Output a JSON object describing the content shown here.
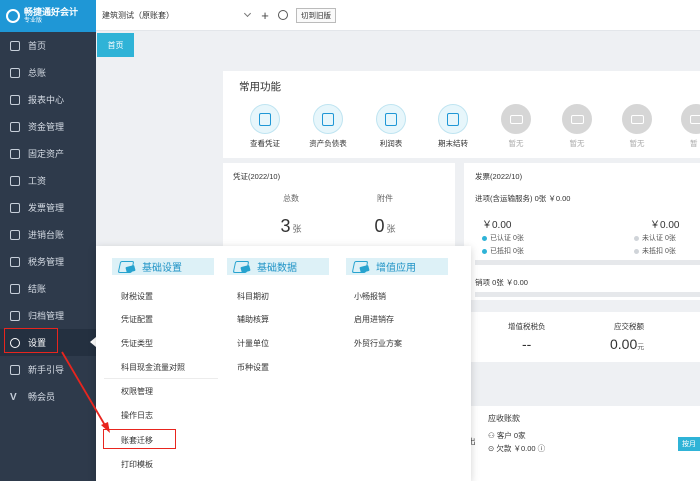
{
  "logo": {
    "title": "畅捷通好会计",
    "edition": "专业版"
  },
  "sidebar": {
    "items": [
      {
        "label": "首页",
        "icon": "home-icon"
      },
      {
        "label": "总账",
        "icon": "ledger-icon"
      },
      {
        "label": "报表中心",
        "icon": "chart-icon"
      },
      {
        "label": "资金管理",
        "icon": "wallet-icon"
      },
      {
        "label": "固定资产",
        "icon": "asset-icon"
      },
      {
        "label": "工资",
        "icon": "salary-icon"
      },
      {
        "label": "发票管理",
        "icon": "invoice-icon"
      },
      {
        "label": "进销台账",
        "icon": "inventory-icon"
      },
      {
        "label": "税务管理",
        "icon": "tax-icon"
      },
      {
        "label": "结账",
        "icon": "close-books-icon"
      },
      {
        "label": "归档管理",
        "icon": "archive-icon"
      },
      {
        "label": "设置",
        "icon": "gear-icon"
      },
      {
        "label": "新手引导",
        "icon": "guide-icon"
      },
      {
        "label": "畅会员",
        "icon": "vip-icon"
      }
    ]
  },
  "topbar": {
    "account_name": "建筑测试（原账套）",
    "switch_label": "切到旧版"
  },
  "tabs": {
    "home": "首页"
  },
  "quick": {
    "title": "常用功能",
    "items": [
      {
        "label": "查看凭证",
        "disabled": false
      },
      {
        "label": "资产负债表",
        "disabled": false
      },
      {
        "label": "利润表",
        "disabled": false
      },
      {
        "label": "期末结转",
        "disabled": false
      },
      {
        "label": "暂无",
        "disabled": true
      },
      {
        "label": "暂无",
        "disabled": true
      },
      {
        "label": "暂无",
        "disabled": true
      },
      {
        "label": "暂",
        "disabled": true
      }
    ]
  },
  "voucher": {
    "title": "凭证(2022/10)",
    "total_label": "总数",
    "total_value": "3",
    "total_unit": "张",
    "attach_label": "附件",
    "attach_value": "0",
    "attach_unit": "张"
  },
  "invoice": {
    "title": "发票(2022/10)",
    "input_line": "进项(含运输服务)  0张  ￥0.00",
    "left_amount": "￥0.00",
    "right_amount": "￥0.00",
    "certified": "已认证  0张",
    "uncertified": "未认证  0张",
    "deducted": "已抵扣  0张",
    "undeducted": "未抵扣  0张",
    "output_line": "销项   0张   ￥0.00"
  },
  "tax": {
    "vat_label": "增值税税负",
    "vat_value": "--",
    "due_label": "应交税额",
    "due_value": "0.00",
    "due_unit": "元"
  },
  "receivable": {
    "title": "应收账款",
    "customers": "客户  0家",
    "owed": "欠款  ￥0.00",
    "month_btn": "按月",
    "edge_text": "出"
  },
  "menu": {
    "basic_settings": {
      "title": "基础设置",
      "items": [
        "财税设置",
        "凭证配置",
        "凭证类型",
        "科目现金流量对照",
        "权限管理",
        "操作日志",
        "账套迁移",
        "打印模板"
      ]
    },
    "basic_data": {
      "title": "基础数据",
      "items": [
        "科目期初",
        "辅助核算",
        "计量单位",
        "币种设置"
      ]
    },
    "value_added": {
      "title": "增值应用",
      "items": [
        "小畅报销",
        "启用进销存",
        "外贸行业方案"
      ]
    }
  },
  "colors": {
    "accent": "#2fb3d7",
    "sidebar": "#2e3a4b",
    "highlight": "#e8251e"
  }
}
